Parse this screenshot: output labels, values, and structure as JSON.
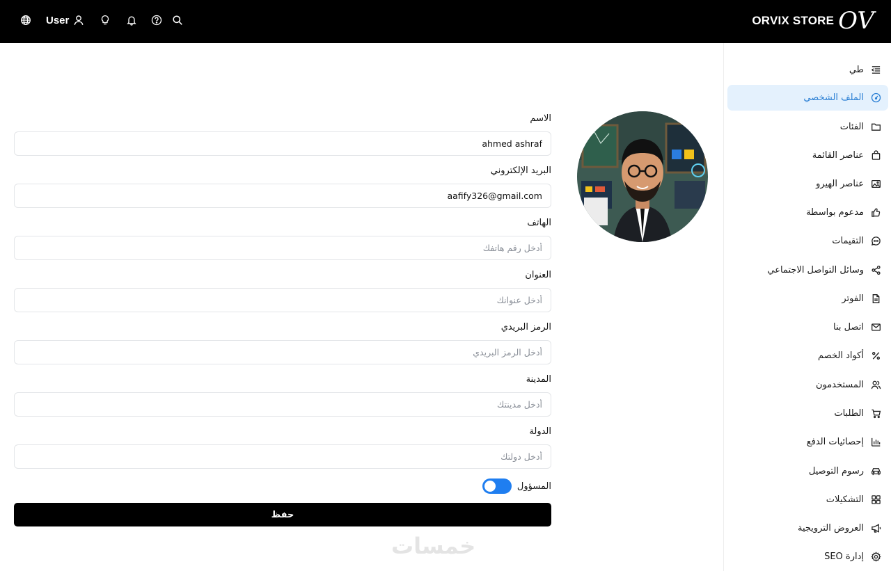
{
  "header": {
    "brand_name": "ORVIX STORE",
    "brand_logo": "OV",
    "user_label": "User",
    "icons": [
      "globe-icon",
      "user-icon",
      "lightbulb-icon",
      "bell-icon",
      "help-icon",
      "search-icon"
    ]
  },
  "sidebar": {
    "items": [
      {
        "label": "طي",
        "icon": "collapse-icon"
      },
      {
        "label": "الملف الشخصي",
        "icon": "dashboard-icon",
        "active": true
      },
      {
        "label": "الفئات",
        "icon": "folder-icon"
      },
      {
        "label": "عناصر القائمة",
        "icon": "bag-icon"
      },
      {
        "label": "عناصر الهيرو",
        "icon": "image-icon"
      },
      {
        "label": "مدعوم بواسطة",
        "icon": "thumbs-up-icon"
      },
      {
        "label": "التقيمات",
        "icon": "chat-icon"
      },
      {
        "label": "وسائل التواصل الاجتماعي",
        "icon": "share-icon"
      },
      {
        "label": "الفوتر",
        "icon": "file-icon"
      },
      {
        "label": "اتصل بنا",
        "icon": "mail-icon"
      },
      {
        "label": "أكواد الخصم",
        "icon": "percent-icon"
      },
      {
        "label": "المستخدمون",
        "icon": "users-icon"
      },
      {
        "label": "الطلبات",
        "icon": "cart-icon"
      },
      {
        "label": "إحصائيات الدفع",
        "icon": "bar-chart-icon"
      },
      {
        "label": "رسوم التوصيل",
        "icon": "car-icon"
      },
      {
        "label": "التشكيلات",
        "icon": "grid-icon"
      },
      {
        "label": "العروض الترويجية",
        "icon": "megaphone-icon"
      },
      {
        "label": "إدارة SEO",
        "icon": "gear-icon"
      }
    ]
  },
  "form": {
    "name": {
      "label": "الاسم",
      "value": "ahmed ashraf",
      "placeholder": ""
    },
    "email": {
      "label": "البريد الإلكتروني",
      "value": "aafify326@gmail.com",
      "placeholder": ""
    },
    "phone": {
      "label": "الهاتف",
      "value": "",
      "placeholder": "أدخل رقم هاتفك"
    },
    "address": {
      "label": "العنوان",
      "value": "",
      "placeholder": "أدخل عنوانك"
    },
    "postal": {
      "label": "الرمز البريدي",
      "value": "",
      "placeholder": "أدخل الرمز البريدي"
    },
    "city": {
      "label": "المدينة",
      "value": "",
      "placeholder": "أدخل مدينتك"
    },
    "country": {
      "label": "الدولة",
      "value": "",
      "placeholder": "أدخل دولتك"
    },
    "admin_toggle": {
      "label": "المسؤول",
      "on": true
    },
    "save_label": "حفظ"
  },
  "watermark": "خمسات",
  "colors": {
    "topbar": "#000000",
    "accent": "#1f7ef0",
    "active_bg": "#e4f1fd",
    "active_text": "#2a7fd4"
  }
}
